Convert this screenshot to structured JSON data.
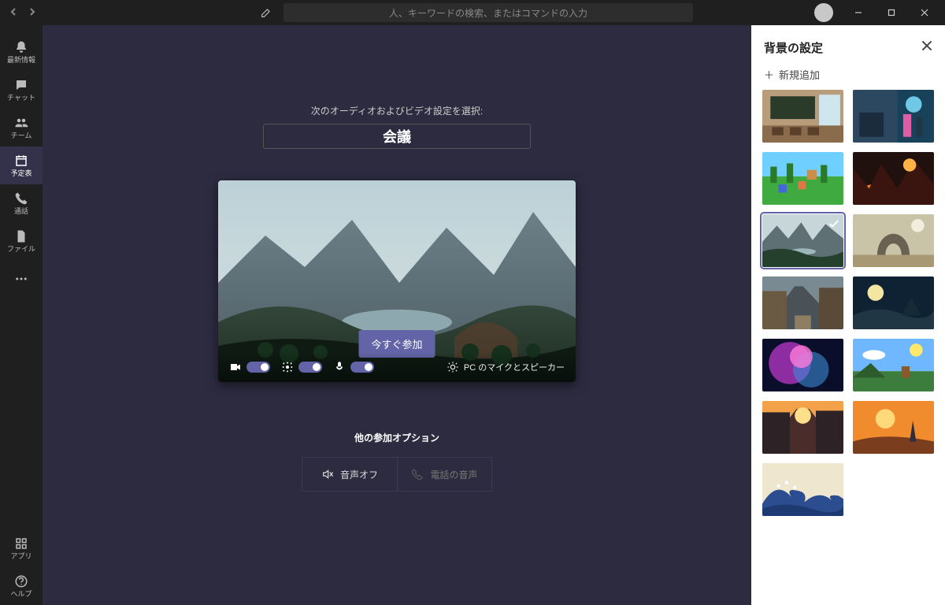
{
  "search": {
    "placeholder": "人、キーワードの検索、またはコマンドの入力"
  },
  "rail": {
    "items": [
      {
        "label": "最新情報"
      },
      {
        "label": "チャット"
      },
      {
        "label": "チーム"
      },
      {
        "label": "予定表"
      },
      {
        "label": "通話"
      },
      {
        "label": "ファイル"
      }
    ],
    "apps_label": "アプリ",
    "help_label": "ヘルプ"
  },
  "stage": {
    "prompt": "次のオーディオおよびビデオ設定を選択:",
    "meeting_name": "会議",
    "join_label": "今すぐ参加",
    "device_text": "PC のマイクとスピーカー",
    "other_title": "他の参加オプション",
    "audio_off": "音声オフ",
    "phone_audio": "電話の音声"
  },
  "panel": {
    "title": "背景の設定",
    "add_new": "新規追加",
    "thumbs": [
      {
        "name": "classroom"
      },
      {
        "name": "sci-fi-room"
      },
      {
        "name": "blocky-voxel"
      },
      {
        "name": "lava-realm"
      },
      {
        "name": "mountain-valley",
        "selected": true
      },
      {
        "name": "stone-arch"
      },
      {
        "name": "old-town"
      },
      {
        "name": "alien-moon"
      },
      {
        "name": "nebula"
      },
      {
        "name": "sunny-day"
      },
      {
        "name": "sunset-street"
      },
      {
        "name": "orange-dusk"
      },
      {
        "name": "great-wave"
      }
    ]
  }
}
